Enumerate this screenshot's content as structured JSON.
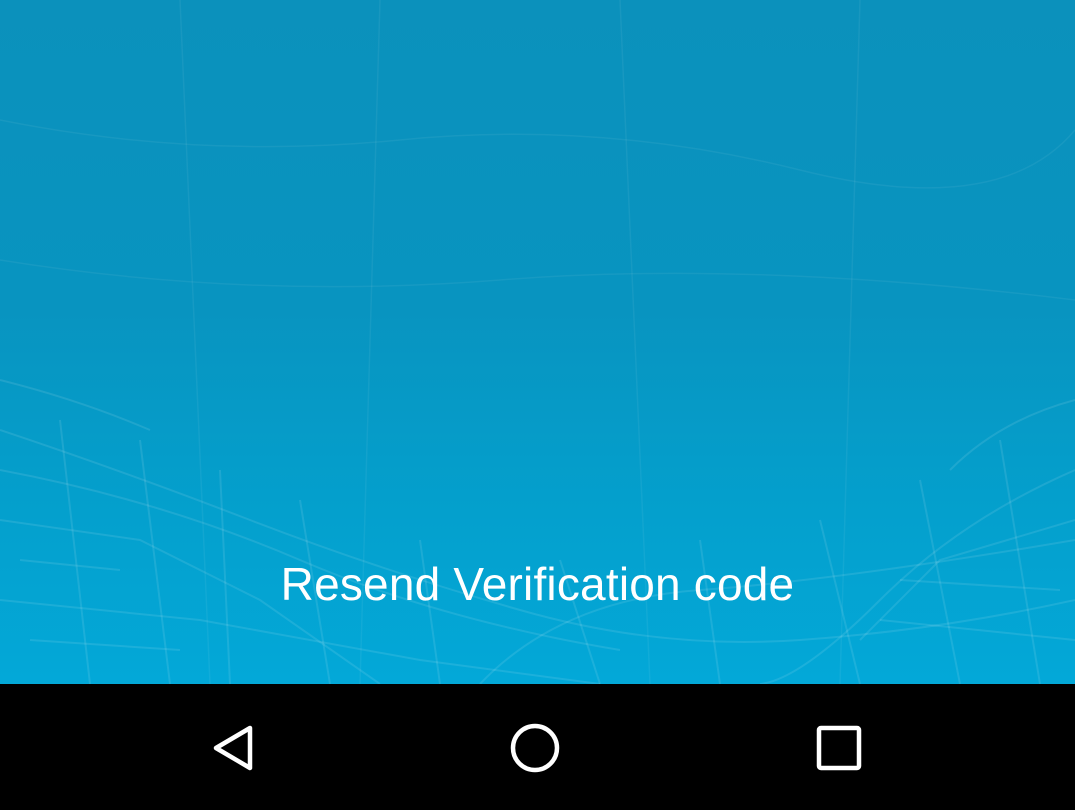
{
  "screen": {
    "resend_link_label": "Resend Verification code"
  },
  "navigation_bar": {
    "buttons": [
      {
        "name": "back",
        "icon": "back-triangle-icon"
      },
      {
        "name": "home",
        "icon": "home-circle-icon"
      },
      {
        "name": "recents",
        "icon": "recents-square-icon"
      }
    ]
  },
  "colors": {
    "background_top": "#0b91bc",
    "background_bottom": "#03a8d8",
    "text": "#ffffff",
    "nav_bar": "#000000"
  }
}
